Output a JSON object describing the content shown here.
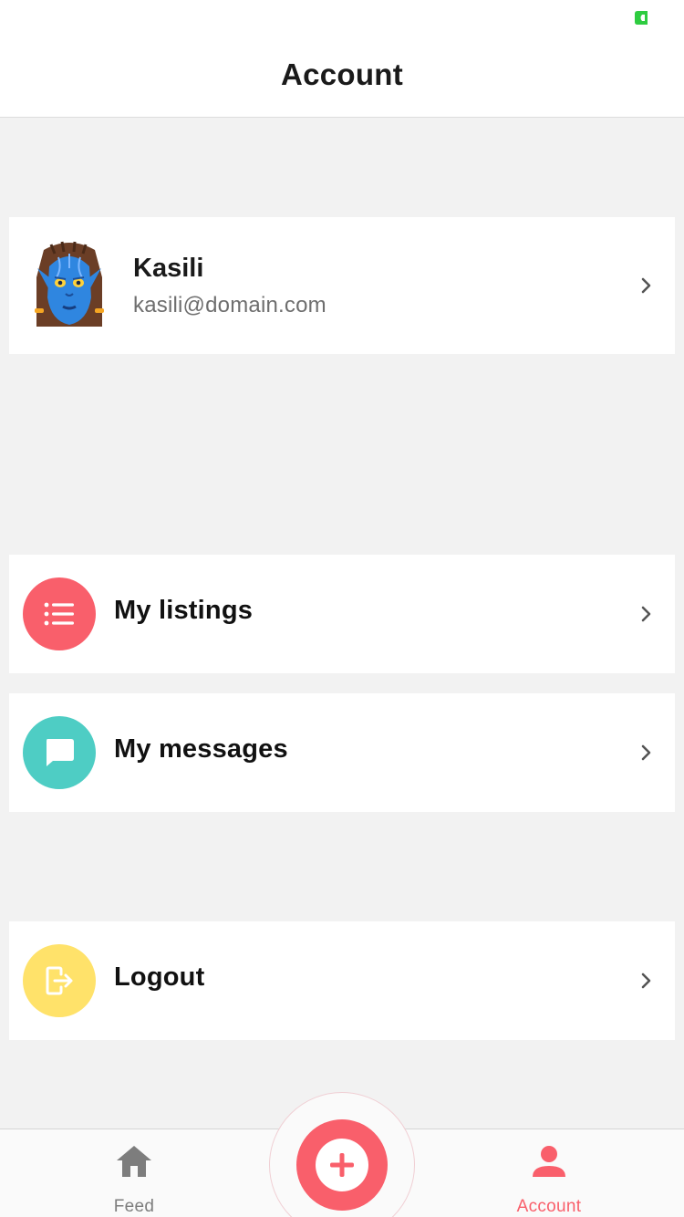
{
  "nav": {
    "title": "Account"
  },
  "profile": {
    "name": "Kasili",
    "email": "kasili@domain.com",
    "avatar_icon": "avatar-alien-icon"
  },
  "menu": {
    "listings": {
      "label": "My listings",
      "icon": "list-icon",
      "color": "#f95f6b"
    },
    "messages": {
      "label": "My messages",
      "icon": "chat-bubble-icon",
      "color": "#4ecdc4"
    },
    "logout": {
      "label": "Logout",
      "icon": "logout-icon",
      "color": "#ffe26a"
    }
  },
  "tabbar": {
    "feed": {
      "label": "Feed",
      "icon": "home-icon",
      "color": "#7d7d7d"
    },
    "add": {
      "icon": "plus-icon",
      "color": "#f95f6b"
    },
    "account": {
      "label": "Account",
      "icon": "person-icon",
      "color": "#f95f6b",
      "active": true
    }
  },
  "status": {
    "battery_color": "#2ecc40"
  }
}
